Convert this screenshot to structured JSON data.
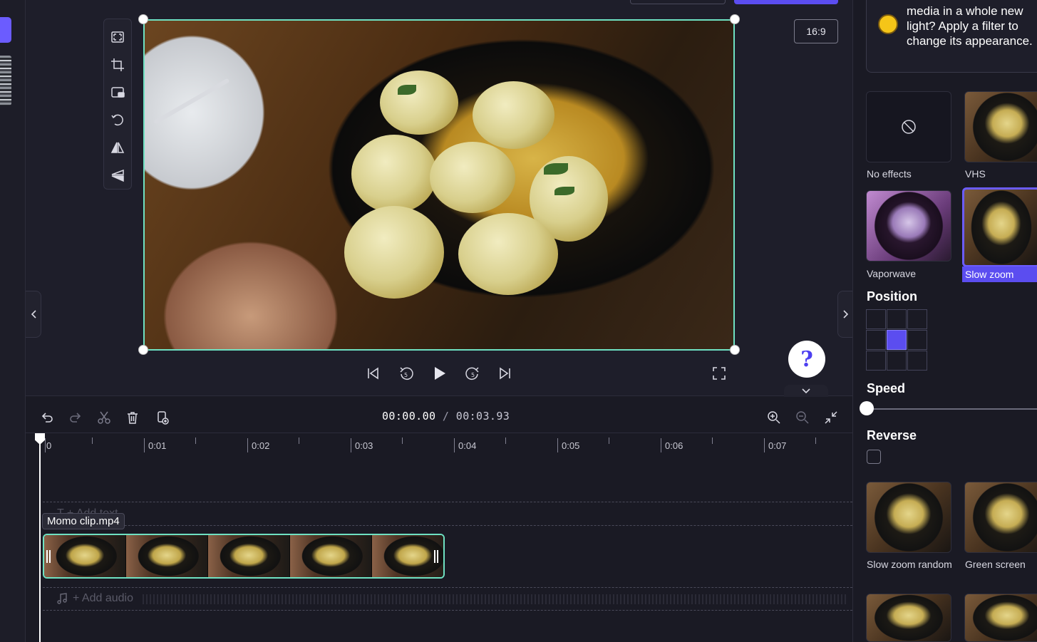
{
  "preview": {
    "aspect_ratio": "16:9",
    "help_glyph": "?"
  },
  "timeline": {
    "current_time": "00:00.00",
    "separator": "/",
    "total_time": "00:03.93",
    "ruler_labels": [
      "0",
      "0:01",
      "0:02",
      "0:03",
      "0:04",
      "0:05",
      "0:06",
      "0:07"
    ],
    "text_track_placeholder": "T  + Add text",
    "clip_name": "Momo clip.mp4",
    "audio_track_placeholder": "+ Add audio"
  },
  "right_panel": {
    "tip_text": "media in a whole new light? Apply a filter to change its appearance.",
    "effects": [
      {
        "label": "No effects"
      },
      {
        "label": "VHS"
      },
      {
        "label": "Vaporwave"
      },
      {
        "label": "Slow zoom",
        "selected": true
      },
      {
        "label": "Slow zoom random"
      },
      {
        "label": "Green screen"
      }
    ],
    "position_title": "Position",
    "position_selected_index": 4,
    "speed_title": "Speed",
    "speed_value_fraction": 0,
    "reverse_title": "Reverse",
    "reverse_checked": false
  },
  "colors": {
    "accent": "#5b4df0",
    "selection": "#6ee1c2",
    "background": "#1a1a24"
  },
  "icons": {
    "toolbar": [
      "fit-icon",
      "crop-icon",
      "picture-in-picture-icon",
      "rotate-icon",
      "flip-horizontal-icon",
      "flip-vertical-icon"
    ],
    "player": [
      "skip-to-start-icon",
      "rewind-5-icon",
      "play-icon",
      "forward-5-icon",
      "skip-to-end-icon",
      "fullscreen-icon"
    ],
    "timeline": [
      "undo-icon",
      "redo-icon",
      "split-icon",
      "delete-icon",
      "duplicate-icon",
      "zoom-in-icon",
      "zoom-out-icon",
      "fit-timeline-icon"
    ]
  }
}
